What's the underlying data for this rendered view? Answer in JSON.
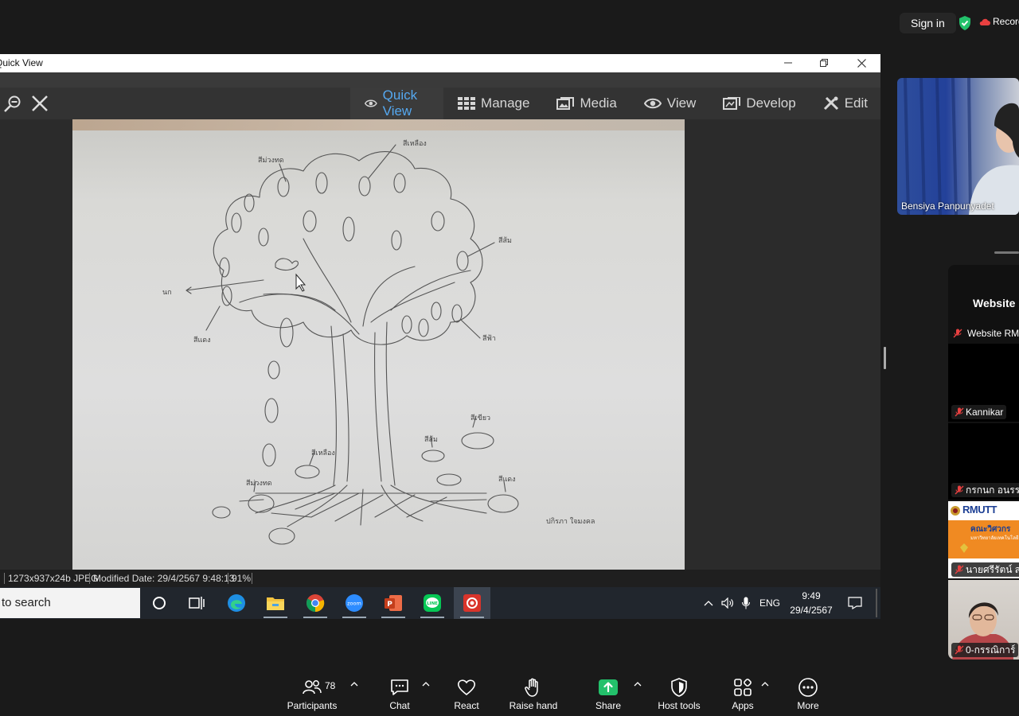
{
  "zoom": {
    "sign_in": "Sign in",
    "recording_label": "Recording",
    "shield_color": "#23c16b",
    "rec_color": "#e84040"
  },
  "viewer": {
    "window_title": "Quick View",
    "window_controls": [
      "minimize-icon",
      "restore-icon",
      "close-icon"
    ],
    "tools": [
      "zoom-out-icon",
      "close-icon"
    ],
    "modes": [
      {
        "label": "Quick View",
        "icon": "eye-icon",
        "active": true
      },
      {
        "label": "Manage",
        "icon": "grid-icon",
        "active": false
      },
      {
        "label": "Media",
        "icon": "media-icon",
        "active": false
      },
      {
        "label": "View",
        "icon": "eye-icon",
        "active": false
      },
      {
        "label": "Develop",
        "icon": "develop-icon",
        "active": false
      },
      {
        "label": "Edit",
        "icon": "edit-icon",
        "active": false
      }
    ],
    "accent_color": "#55a8f0",
    "status": {
      "info": "1273x937x24b JPEG",
      "modified": "Modified Date: 29/4/2567 9:48:13",
      "zoom": "91%"
    },
    "drawing_annotations": {
      "top_a": "สีม่วงทด",
      "top_b": "สีเหลือง",
      "right_a": "สีส้ม",
      "left_bird": "นก",
      "left_a": "สีแดง",
      "right_b": "สีฟ้า",
      "ground_a": "สีเขียว",
      "ground_b": "สีส้ม",
      "ground_c": "สีเหลือง",
      "ground_d": "สีม่วงทด",
      "ground_e": "สีแดง",
      "signature": "ปกิรภา ใจมงคล"
    }
  },
  "taskbar": {
    "search_placeholder": "to search",
    "apps": [
      "cortana-icon",
      "task-view-icon",
      "edge-icon",
      "file-explorer-icon",
      "chrome-icon",
      "zoom-icon",
      "powerpoint-icon",
      "line-icon",
      "acdsee-icon"
    ],
    "lang": "ENG",
    "time": "9:49",
    "date": "29/4/2567"
  },
  "participants": {
    "speaker_name": "Bensiya Panpunyadet",
    "gallery_title": "Website",
    "tiles": [
      {
        "name": "Website RMUTT"
      },
      {
        "name": "Kannikar"
      },
      {
        "name": "กรกนก อนรรฆ"
      },
      {
        "name": "นายศรีรัตน์ ส"
      },
      {
        "name": "0-กรรณิการ์"
      }
    ],
    "rmutt_logo_text": "RMUTT",
    "rmutt_banner": "คณะวิศวกร",
    "rmutt_sub": "มหาวิทยาลัยเทคโนโลยี"
  },
  "controls": {
    "participants_label": "Participants",
    "participants_count": "78",
    "chat_label": "Chat",
    "react_label": "React",
    "raise_hand_label": "Raise hand",
    "share_label": "Share",
    "host_tools_label": "Host tools",
    "apps_label": "Apps",
    "more_label": "More",
    "share_color": "#23c16b"
  }
}
